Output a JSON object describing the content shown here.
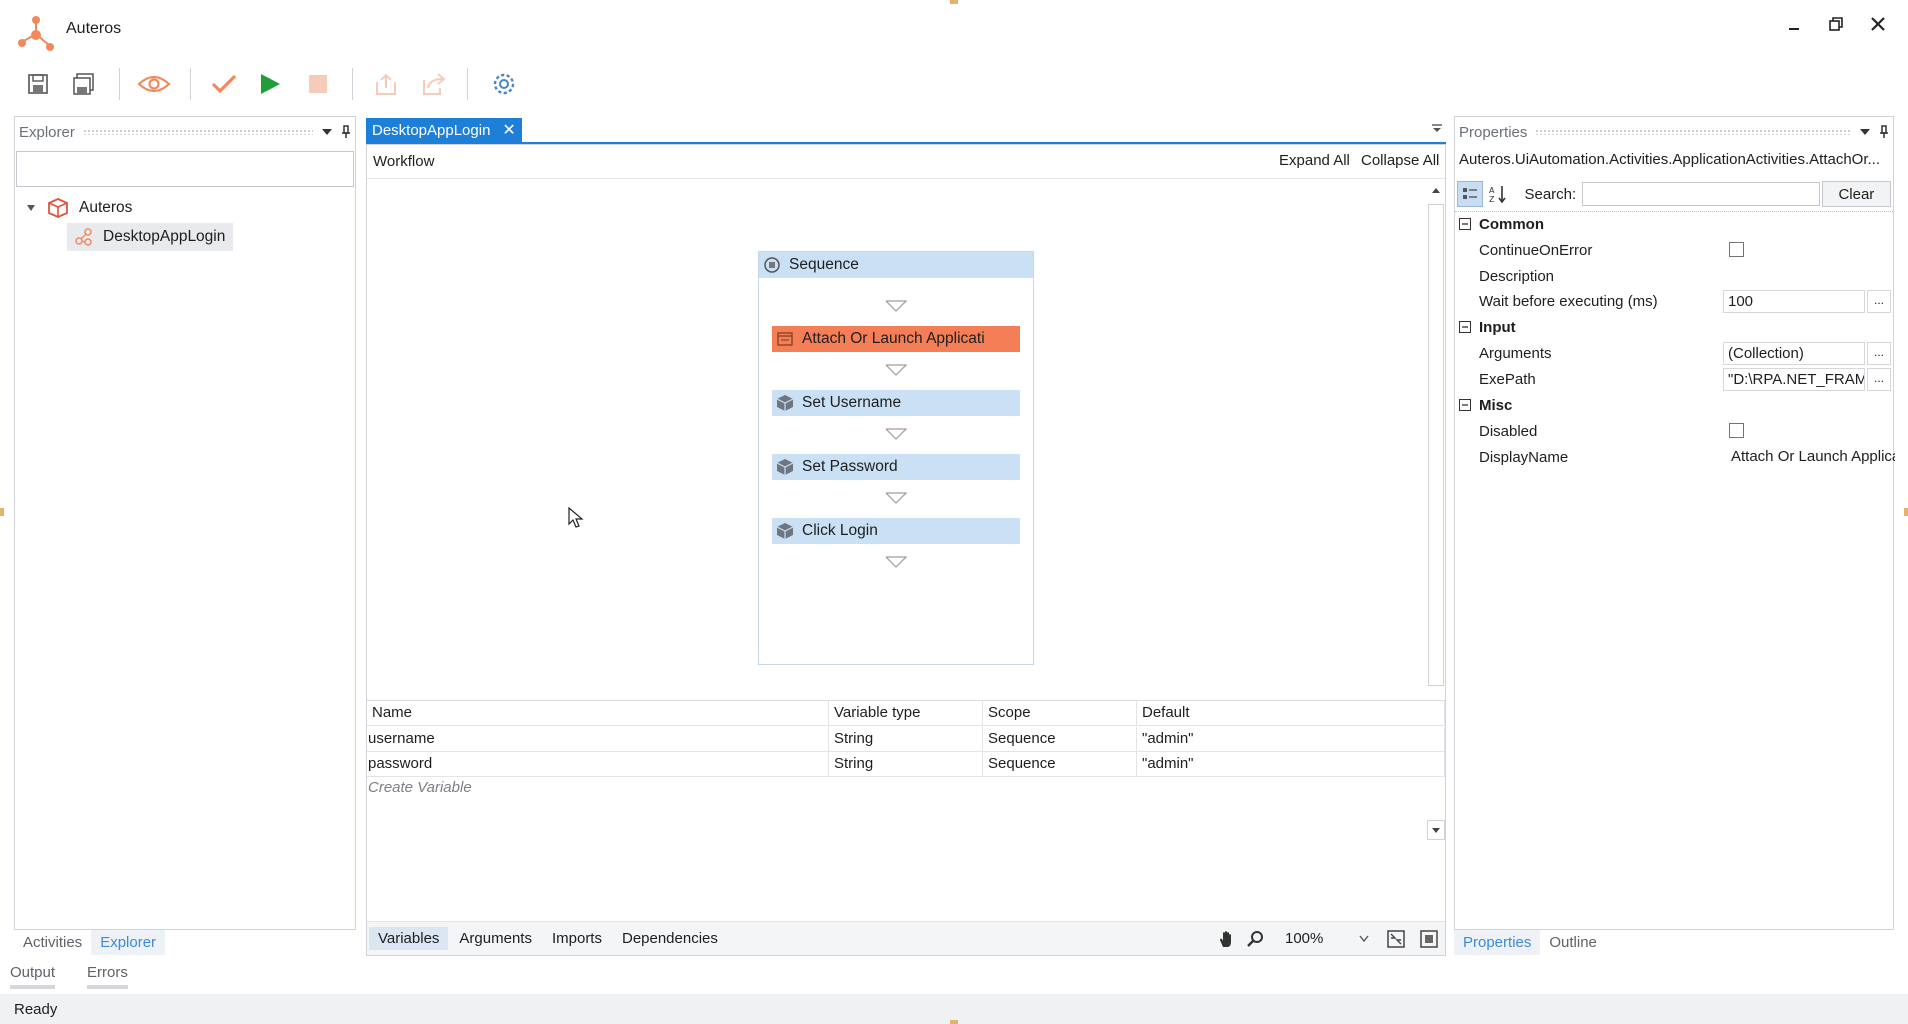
{
  "app": {
    "title": "Auteros"
  },
  "toolbar": {
    "icons": [
      "save-icon",
      "save-all-icon",
      "eye-icon",
      "check-icon",
      "play-icon",
      "stop-icon",
      "export-icon",
      "share-icon",
      "settings-gear-icon"
    ],
    "accent_color": "#1d7fd8",
    "selected_color": "#f47f57"
  },
  "explorer": {
    "title": "Explorer",
    "search_value": "",
    "tree": {
      "project": "Auteros",
      "child": "DesktopAppLogin"
    },
    "tabs": {
      "activities": "Activities",
      "explorer": "Explorer"
    }
  },
  "designer": {
    "tab_label": "DesktopAppLogin",
    "breadcrumb": "Workflow",
    "expand_all": "Expand All",
    "collapse_all": "Collapse All",
    "sequence": {
      "title": "Sequence",
      "activities": [
        {
          "label": "Attach Or Launch Applicati",
          "selected": true
        },
        {
          "label": "Set Username",
          "selected": false
        },
        {
          "label": "Set Password",
          "selected": false
        },
        {
          "label": "Click Login",
          "selected": false
        }
      ]
    },
    "variables": {
      "headers": {
        "name": "Name",
        "type": "Variable type",
        "scope": "Scope",
        "default": "Default"
      },
      "rows": [
        {
          "name": "username",
          "type": "String",
          "scope": "Sequence",
          "default": "\"admin\""
        },
        {
          "name": "password",
          "type": "String",
          "scope": "Sequence",
          "default": "\"admin\""
        }
      ],
      "create_placeholder": "Create Variable"
    },
    "bottom_tabs": {
      "variables": "Variables",
      "arguments": "Arguments",
      "imports": "Imports",
      "dependencies": "Dependencies"
    },
    "zoom": "100%"
  },
  "properties": {
    "title": "Properties",
    "target": "Auteros.UiAutomation.Activities.ApplicationActivities.AttachOr...",
    "search_label": "Search:",
    "search_value": "",
    "clear_label": "Clear",
    "sections": {
      "common": "Common",
      "input": "Input",
      "misc": "Misc"
    },
    "rows": {
      "continue_on_error": "ContinueOnError",
      "description": "Description",
      "wait_before": "Wait before executing (ms)",
      "wait_value": "100",
      "arguments": "Arguments",
      "arguments_value": "(Collection)",
      "exe_path": "ExePath",
      "exe_path_value": "\"D:\\RPA.NET_FRAMEW",
      "disabled": "Disabled",
      "display_name": "DisplayName",
      "display_name_value": "Attach Or Launch Applica"
    },
    "ellipsis": "...",
    "tabs": {
      "properties": "Properties",
      "outline": "Outline"
    }
  },
  "output": {
    "output_tab": "Output",
    "errors_tab": "Errors"
  },
  "status": {
    "text": "Ready"
  }
}
